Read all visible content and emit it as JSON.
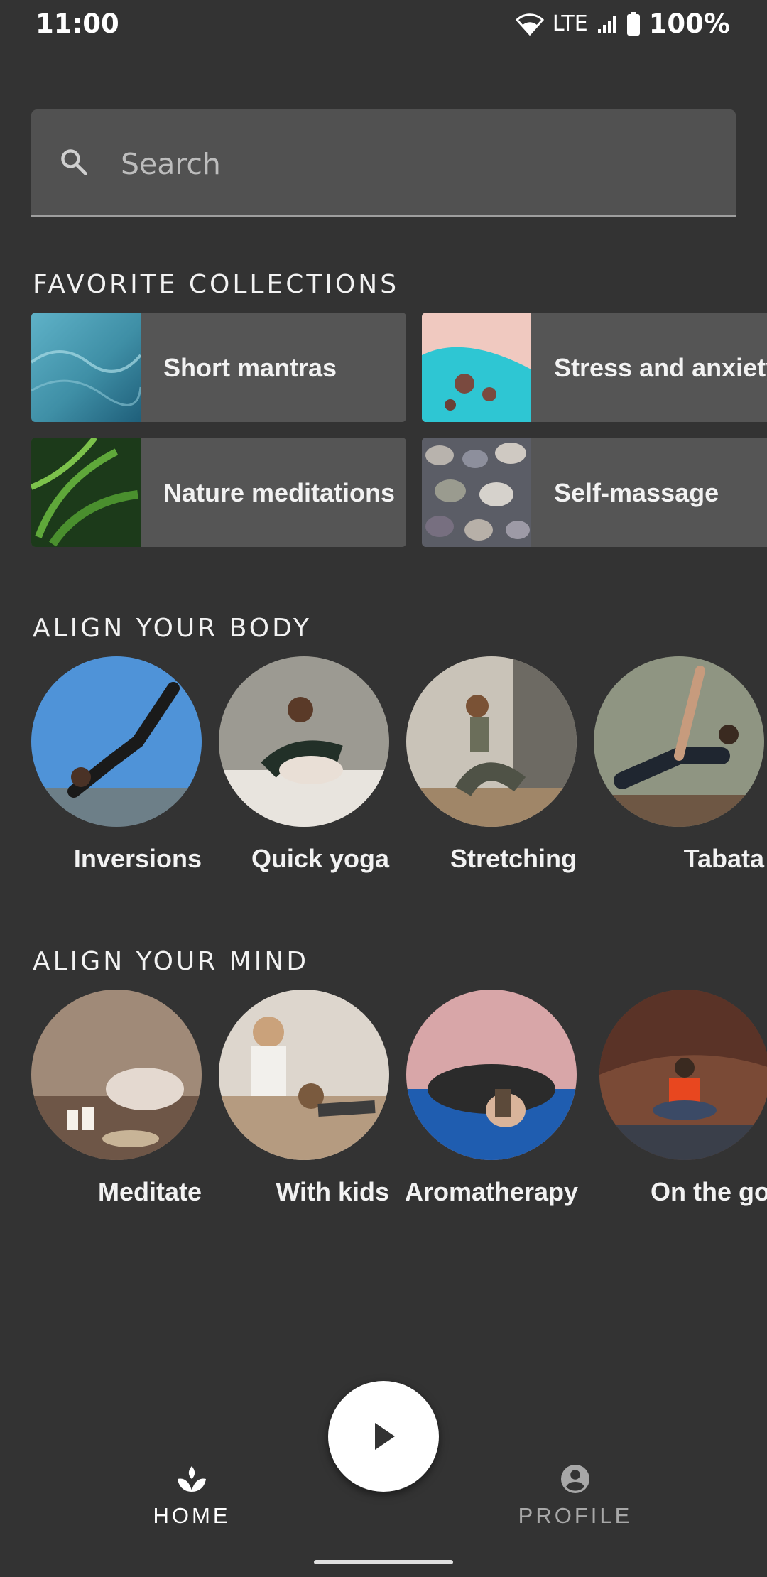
{
  "status_bar": {
    "time": "11:00",
    "network": "LTE",
    "battery": "100%"
  },
  "search": {
    "placeholder": "Search"
  },
  "favorite_collections": {
    "title": "FAVORITE COLLECTIONS",
    "items": [
      {
        "label": "Short mantras",
        "icon": "ocean-wave-thumbnail"
      },
      {
        "label": "Stress and anxiety",
        "icon": "aerial-beach-thumbnail"
      },
      {
        "label": "Nature meditations",
        "icon": "palm-leaves-thumbnail"
      },
      {
        "label": "Self-massage",
        "icon": "pebbles-thumbnail"
      }
    ]
  },
  "align_body": {
    "title": "ALIGN YOUR BODY",
    "items": [
      {
        "label": "Inversions"
      },
      {
        "label": "Quick yoga"
      },
      {
        "label": "Stretching"
      },
      {
        "label": "Tabata"
      }
    ]
  },
  "align_mind": {
    "title": "ALIGN YOUR MIND",
    "items": [
      {
        "label": "Meditate"
      },
      {
        "label": "With kids"
      },
      {
        "label": "Aromatherapy"
      },
      {
        "label": "On the go"
      }
    ]
  },
  "bottom_nav": {
    "home_label": "HOME",
    "profile_label": "PROFILE",
    "active_color": "#ffffff",
    "inactive_color": "#a8a8a8"
  }
}
